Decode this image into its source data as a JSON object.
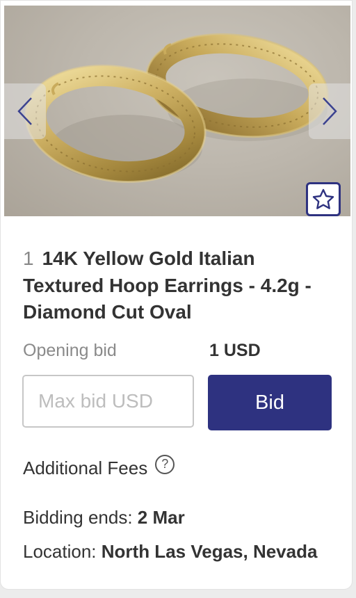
{
  "listing": {
    "lot_number": "1",
    "title": "14K Yellow Gold Italian Textured Hoop Earrings - 4.2g - Diamond Cut Oval",
    "opening_bid_label": "Opening bid",
    "opening_bid_value": "1 USD",
    "max_bid_placeholder": "Max bid USD",
    "bid_button_label": "Bid",
    "additional_fees_label": "Additional Fees",
    "help_icon_glyph": "?",
    "bidding_ends_label": "Bidding ends:",
    "bidding_ends_value": "2 Mar",
    "location_label": "Location:",
    "location_value": "North Las Vegas, Nevada"
  },
  "icons": {
    "prev": "chevron-left-icon",
    "next": "chevron-right-icon",
    "favorite": "star-outline-icon",
    "help": "question-circle-icon"
  },
  "colors": {
    "accent": "#2e3280",
    "text_primary": "#333333",
    "text_muted": "#8a8a8a",
    "input_border": "#c7c7c7",
    "background": "#ececec"
  }
}
